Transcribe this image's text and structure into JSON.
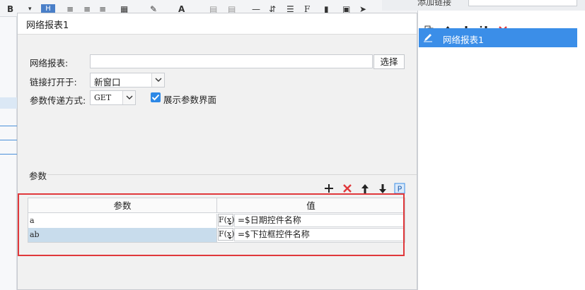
{
  "dialog": {
    "title": "网络报表1",
    "report_label": "网络报表:",
    "report_value": "",
    "choose_label": "选择",
    "open_in_label": "链接打开于:",
    "open_in_value": "新窗口",
    "method_label": "参数传递方式:",
    "method_value": "GET",
    "show_param_label": "展示参数界面",
    "show_param_checked": true
  },
  "params": {
    "section_label": "参数",
    "columns": [
      "参数",
      "值"
    ],
    "rows": [
      {
        "name": "a",
        "value": "=$日期控件名称",
        "selected": false
      },
      {
        "name": "ab",
        "value": "=$下拉框控件名称",
        "selected": true
      }
    ],
    "fx_label": "F(x)"
  },
  "right_panel": {
    "header_label": "添加链接",
    "links": [
      "网络报表1"
    ]
  },
  "colors": {
    "accent": "#3b8ee8",
    "highlight": "#e0383b",
    "selected_row": "#c8dcec"
  }
}
